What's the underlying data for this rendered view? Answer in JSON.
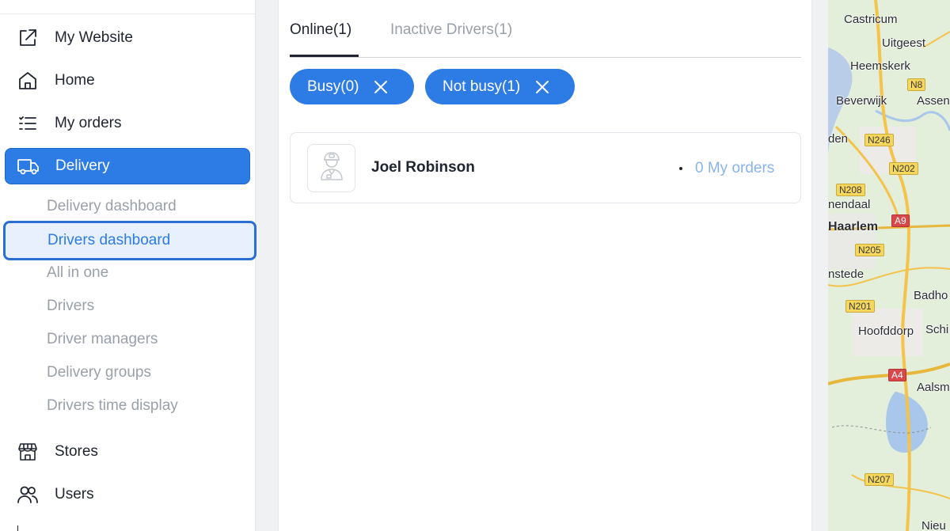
{
  "sidebar": {
    "items": [
      {
        "label": "My Website",
        "icon": "external-link-icon"
      },
      {
        "label": "Home",
        "icon": "home-icon"
      },
      {
        "label": "My orders",
        "icon": "list-icon"
      },
      {
        "label": "Delivery",
        "icon": "truck-icon"
      },
      {
        "label": "Stores",
        "icon": "store-icon"
      },
      {
        "label": "Users",
        "icon": "users-icon"
      }
    ],
    "delivery_sub": [
      "Delivery dashboard",
      "Drivers dashboard",
      "All in one",
      "Drivers",
      "Driver managers",
      "Delivery groups",
      "Drivers time display"
    ]
  },
  "main": {
    "tabs": [
      {
        "label": "Online(1)"
      },
      {
        "label": "Inactive Drivers(1)"
      }
    ],
    "filters": [
      {
        "label": "Busy(0)"
      },
      {
        "label": "Not busy(1)"
      }
    ],
    "drivers": [
      {
        "name": "Joel Robinson",
        "orders_label": "0 My orders"
      }
    ]
  },
  "map": {
    "places": [
      "Castricum",
      "Uitgeest",
      "Heemskerk",
      "Beverwijk",
      "Assend",
      "den",
      "nendaal",
      "Haarlem",
      "nstede",
      "Badho",
      "Hoofddorp",
      "Schi",
      "Aalsm",
      "Nieu"
    ],
    "roads": [
      "N8",
      "N246",
      "N202",
      "N208",
      "A9",
      "N205",
      "N201",
      "A4",
      "N207"
    ]
  },
  "colors": {
    "accent": "#2d7be5",
    "muted_text": "#9aa0aa",
    "link_text": "#8ab3ec"
  }
}
